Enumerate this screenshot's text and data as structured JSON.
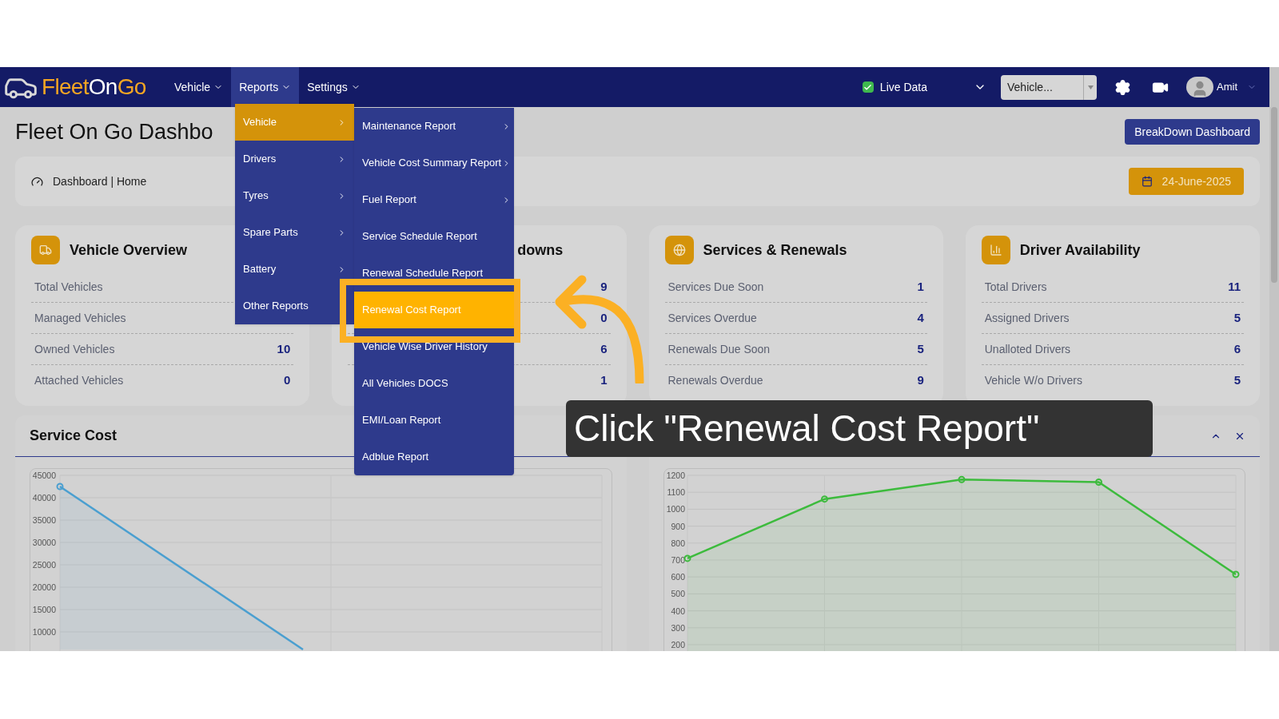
{
  "header": {
    "logo": [
      {
        "text": "Fleet",
        "color": "#f5a623"
      },
      {
        "text": "On",
        "color": "#ffffff"
      },
      {
        "text": "Go",
        "color": "#f5a623"
      }
    ],
    "nav": [
      {
        "label": "Vehicle",
        "selected": false
      },
      {
        "label": "Reports",
        "selected": true
      },
      {
        "label": "Settings",
        "selected": false
      }
    ],
    "live_data": {
      "label": "Live Data",
      "checked": true
    },
    "vehicle_select": {
      "value": "Vehicle..."
    },
    "user": {
      "name": "Amit"
    }
  },
  "page": {
    "title": "Fleet On Go Dashbo",
    "breakdown_button": "BreakDown Dashboard",
    "breadcrumb": "Dashboard | Home",
    "date": "24-June-2025"
  },
  "cards": [
    {
      "title": "Vehicle Overview",
      "rows": [
        {
          "label": "Total Vehicles"
        },
        {
          "label": "Managed Vehicles"
        },
        {
          "label": "Owned Vehicles",
          "value": "10"
        },
        {
          "label": "Attached Vehicles",
          "value": "0"
        }
      ]
    },
    {
      "title": "downs",
      "rows": [
        {
          "value": "9"
        },
        {
          "value": "0"
        },
        {
          "value": "6"
        },
        {
          "value": "1"
        }
      ]
    },
    {
      "title": "Services & Renewals",
      "rows": [
        {
          "label": "Services Due Soon",
          "value": "1"
        },
        {
          "label": "Services Overdue",
          "value": "4"
        },
        {
          "label": "Renewals Due Soon",
          "value": "5"
        },
        {
          "label": "Renewals Overdue",
          "value": "9"
        }
      ]
    },
    {
      "title": "Driver Availability",
      "rows": [
        {
          "label": "Total Drivers",
          "value": "11"
        },
        {
          "label": "Assigned Drivers",
          "value": "5"
        },
        {
          "label": "Unalloted Drivers",
          "value": "6"
        },
        {
          "label": "Vehicle W/o Drivers",
          "value": "5"
        }
      ]
    }
  ],
  "charts": [
    {
      "title": "Service Cost",
      "y_axis_labels": [
        "45000",
        "40000",
        "35000",
        "30000",
        "25000",
        "20000",
        "15000",
        "10000"
      ]
    },
    {
      "chart_data": {
        "type": "area",
        "grid": true,
        "categories": [
          null,
          null,
          null,
          null,
          null
        ],
        "ylim": [
          0,
          1200
        ],
        "yticks": [
          200,
          300,
          400,
          500,
          600,
          700,
          800,
          900,
          1000,
          1100,
          1200
        ],
        "series": [
          {
            "color": "#3dbb3d",
            "values": [
              710,
              1060,
              1175,
              1160,
              615
            ]
          }
        ]
      }
    }
  ],
  "reports_menu": [
    {
      "label": "Vehicle",
      "selected": true
    },
    {
      "label": "Drivers",
      "selected": false
    },
    {
      "label": "Tyres",
      "selected": false
    },
    {
      "label": "Spare Parts",
      "selected": false
    },
    {
      "label": "Battery",
      "selected": false
    },
    {
      "label": "Other Reports",
      "selected": false
    }
  ],
  "vehicle_submenu": [
    {
      "label": "Maintenance Report",
      "selected": false,
      "has_submenu": true
    },
    {
      "label": "Vehicle Cost Summary Report",
      "selected": false,
      "has_submenu": true
    },
    {
      "label": "Fuel Report",
      "selected": false,
      "has_submenu": true
    },
    {
      "label": "Service Schedule Report",
      "selected": false,
      "has_submenu": false
    },
    {
      "label": "Renewal Schedule Report",
      "selected": false,
      "has_submenu": false
    },
    {
      "label": "Renewal Cost Report",
      "selected": true,
      "has_submenu": false
    },
    {
      "label": "Vehicle Wise Driver History",
      "selected": false,
      "has_submenu": false
    },
    {
      "label": "All Vehicles DOCS",
      "selected": false,
      "has_submenu": false
    },
    {
      "label": "EMI/Loan Report",
      "selected": false,
      "has_submenu": false
    },
    {
      "label": "Adblue Report",
      "selected": false,
      "has_submenu": false
    }
  ],
  "tutorial": {
    "caption": "Click \"Renewal Cost Report\""
  }
}
